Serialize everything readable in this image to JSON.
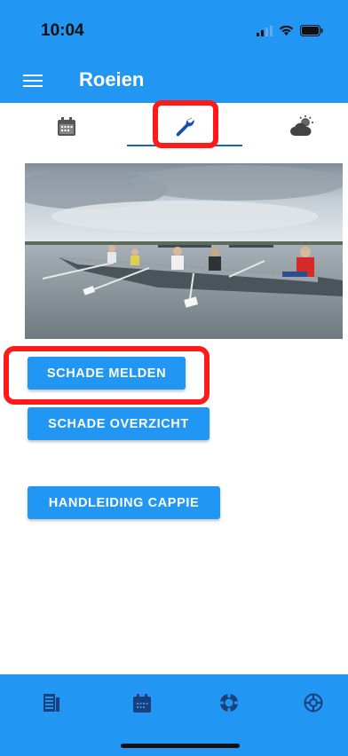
{
  "status_bar": {
    "time": "10:04"
  },
  "app_bar": {
    "title": "Roeien"
  },
  "tabs": [
    {
      "icon": "calendar-icon"
    },
    {
      "icon": "wrench-icon",
      "selected": true
    },
    {
      "icon": "weather-icon"
    }
  ],
  "hero_image": {
    "description_icon": "rowing-photo"
  },
  "buttons": {
    "schade_melden": "SCHADE MELDEN",
    "schade_overzicht": "SCHADE OVERZICHT",
    "handleiding_cappie": "HANDLEIDING CAPPIE"
  },
  "bottom_nav": [
    {
      "icon": "news-icon"
    },
    {
      "icon": "calendar-icon"
    },
    {
      "icon": "lifebuoy-icon"
    },
    {
      "icon": "wheel-icon"
    }
  ],
  "colors": {
    "primary": "#2196f3",
    "highlight": "#ff1a1a",
    "indicator": "#1565c0"
  }
}
